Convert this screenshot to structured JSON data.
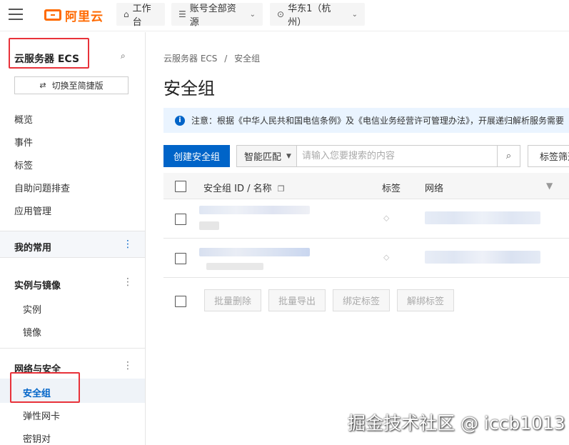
{
  "topbar": {
    "logo_text": "阿里云",
    "workbench": "工作台",
    "resources": "账号全部资源",
    "region": "华东1（杭州）"
  },
  "sidebar": {
    "title": "云服务器 ECS",
    "switch_label": "切换至简捷版",
    "items": [
      "概览",
      "事件",
      "标签",
      "自助问题排查",
      "应用管理"
    ],
    "favorites": "我的常用",
    "group_instances": {
      "label": "实例与镜像",
      "items": [
        "实例",
        "镜像"
      ]
    },
    "group_network": {
      "label": "网络与安全",
      "items": [
        "安全组",
        "弹性网卡",
        "密钥对"
      ]
    }
  },
  "main": {
    "breadcrumb_root": "云服务器 ECS",
    "breadcrumb_sep": "/",
    "breadcrumb_current": "安全组",
    "title": "安全组",
    "notice": "注意：根据《中华人民共和国电信条例》及《电信业务经营许可管理办法》，开展递归解析服务需要",
    "create_button": "创建安全组",
    "search_mode": "智能匹配",
    "search_placeholder": "请输入您要搜索的内容",
    "tag_filter": "标签筛选",
    "columns": {
      "id_name": "安全组 ID / 名称",
      "tags": "标签",
      "network": "网络"
    },
    "bulk": [
      "批量删除",
      "批量导出",
      "绑定标签",
      "解绑标签"
    ]
  },
  "watermark": "掘金技术社区 @ iccb1013",
  "colors": {
    "brand": "#ff6a00",
    "primary": "#0064c8",
    "highlight": "#e8323a"
  },
  "icons": [
    "menu-icon",
    "home-icon",
    "list-icon",
    "location-icon",
    "search-icon",
    "swap-icon",
    "kebab-icon",
    "info-icon",
    "copy-icon",
    "filter-icon",
    "tag-icon"
  ]
}
